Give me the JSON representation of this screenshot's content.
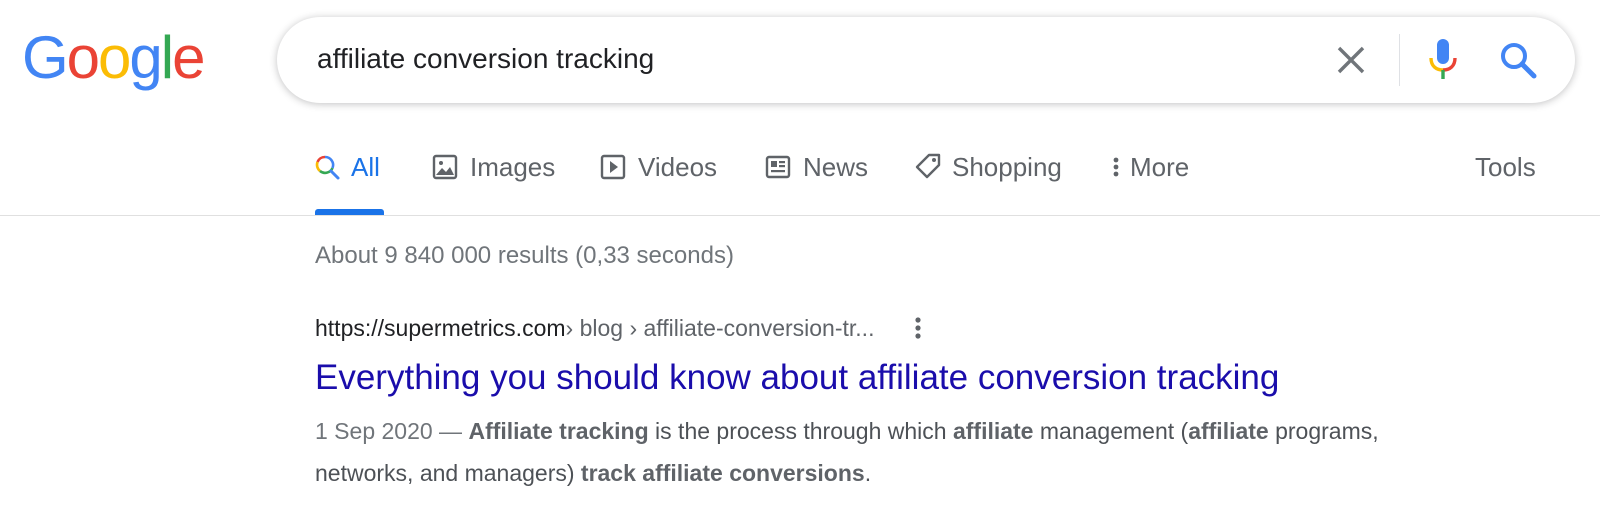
{
  "logo": {
    "letters": [
      "G",
      "o",
      "o",
      "g",
      "l",
      "e"
    ],
    "colors": [
      "#4285F4",
      "#EA4335",
      "#FBBC05",
      "#4285F4",
      "#34A853",
      "#EA4335"
    ]
  },
  "search": {
    "query": "affiliate conversion tracking"
  },
  "tabs": {
    "all": "All",
    "images": "Images",
    "videos": "Videos",
    "news": "News",
    "shopping": "Shopping",
    "more": "More",
    "tools": "Tools",
    "active": "all"
  },
  "results": {
    "stats": "About 9 840 000 results (0,33 seconds)",
    "items": [
      {
        "host": "https://supermetrics.com",
        "path": " › blog › affiliate-conversion-tr...",
        "title": "Everything you should know about affiliate conversion tracking",
        "snippet": {
          "date": "1 Sep 2020",
          "sep": " — ",
          "p1": "Affiliate tracking",
          "p2": " is the process through which ",
          "p3": "affiliate",
          "p4": " management (",
          "p5": "affiliate",
          "p6": " programs, networks, and managers) ",
          "p7": "track affiliate conversions",
          "p8": "."
        }
      }
    ]
  },
  "colors": {
    "link": "#1a0dab",
    "accent": "#1a73e8",
    "text_secondary": "#5f6368"
  },
  "icons": {
    "clear": "close-icon",
    "mic": "microphone-icon",
    "search": "search-icon",
    "tab_all": "search-multicolor-icon",
    "tab_images": "image-icon",
    "tab_videos": "play-icon",
    "tab_news": "newspaper-icon",
    "tab_shopping": "tag-icon",
    "tab_more": "vertical-dots-icon",
    "result_menu": "vertical-dots-icon"
  }
}
